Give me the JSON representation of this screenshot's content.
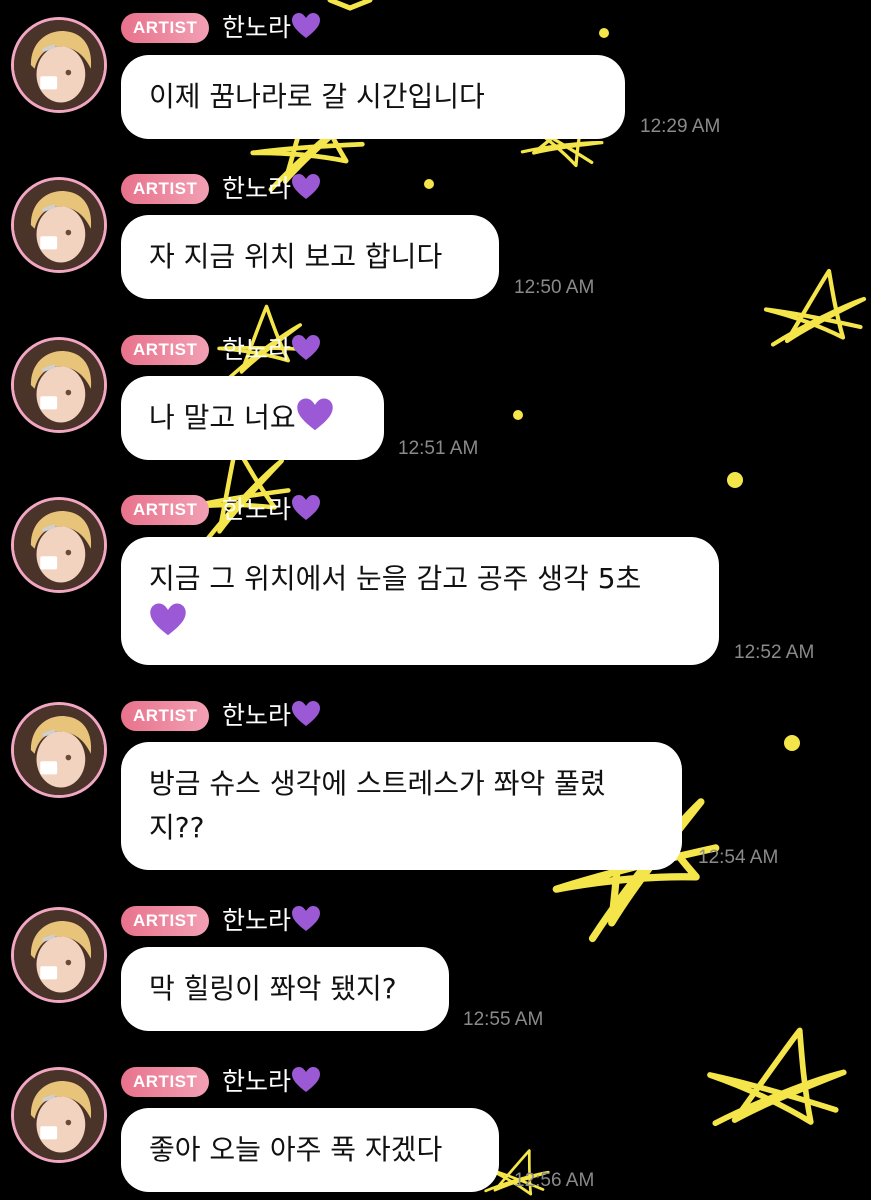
{
  "badge_label": "ARTIST",
  "sender_name": "한노라",
  "accent_colors": {
    "badge_gradient_start": "#e8728c",
    "badge_gradient_end": "#f2a0b4",
    "avatar_ring": "#f1a7c3",
    "heart": "#9b59d6",
    "doodle": "#f4e64a",
    "timestamp": "#8a8a8a"
  },
  "icons": {
    "name_suffix": "purple-heart-icon",
    "background": "yellow-star-doodle-icon"
  },
  "messages": [
    {
      "text": "이제 꿈나라로 갈 시간입니다",
      "time": "12:29 AM",
      "heart_in_text": false
    },
    {
      "text": "자 지금 위치 보고 합니다",
      "time": "12:50 AM",
      "heart_in_text": false
    },
    {
      "text": "나 말고 너요",
      "time": "12:51 AM",
      "heart_in_text": true
    },
    {
      "text_line1": "지금 그 위치에서 눈을 감고 공주 생각 5초",
      "time": "12:52 AM",
      "heart_in_text": true
    },
    {
      "text_line1": "방금 슈스 생각에 스트레스가 쫘악 풀렸",
      "text_line2": "지??",
      "time": "12:54 AM",
      "heart_in_text": false
    },
    {
      "text": "막 힐링이 쫘악 됐지?",
      "time": "12:55 AM",
      "heart_in_text": false
    },
    {
      "text": "좋아 오늘 아주 푹 자겠다",
      "time": "12:56 AM",
      "heart_in_text": false
    }
  ]
}
